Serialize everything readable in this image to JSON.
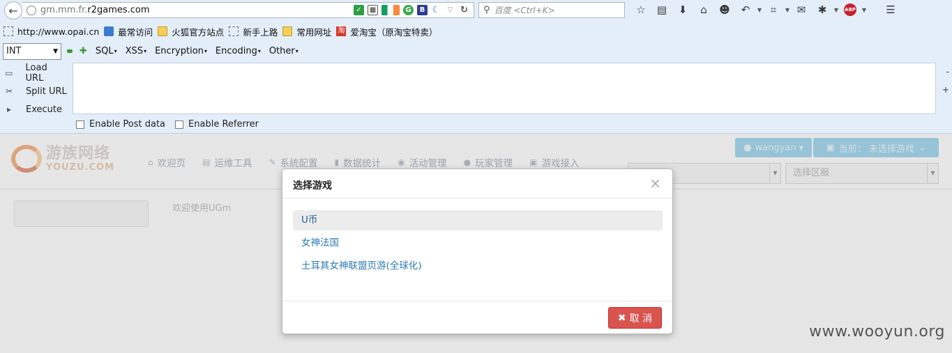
{
  "browser": {
    "url_prefix": "gm.mm.fr.",
    "url_domain": "r2games.com",
    "search_placeholder": "百度 <Ctrl+K>",
    "toolbar_icons": [
      "star-icon",
      "reading-list-icon",
      "download-icon",
      "home-icon",
      "smiley-icon",
      "undo-icon",
      "crop-icon",
      "chat-icon",
      "bug-icon",
      "adblock-icon",
      "menu-icon"
    ],
    "adblock_label": "ABP"
  },
  "bookmarks": [
    {
      "label": "http://www.opai.cn",
      "icon": "dashed-page-icon"
    },
    {
      "label": "最常访问",
      "icon": "blue-page-icon"
    },
    {
      "label": "火狐官方站点",
      "icon": "folder-icon"
    },
    {
      "label": "新手上路",
      "icon": "dashed-page-icon"
    },
    {
      "label": "常用网址",
      "icon": "folder-icon"
    },
    {
      "label": "爱淘宝（原淘宝特卖）",
      "icon": "taobao-icon",
      "icon_text": "淘"
    }
  ],
  "hackbar": {
    "select_value": "INT",
    "menus": [
      "SQL",
      "XSS",
      "Encryption",
      "Encoding",
      "Other"
    ],
    "load_url": "Load URL",
    "split_url": "Split URL",
    "execute": "Execute",
    "minus": "-",
    "plus": "+",
    "enable_post": "Enable Post data",
    "enable_referrer": "Enable Referrer"
  },
  "site": {
    "logo_cn": "游族网络",
    "logo_en": "YOUZU.COM",
    "nav": [
      {
        "label": "欢迎页",
        "icon": "home-icon",
        "glyph": "⌂"
      },
      {
        "label": "运维工具",
        "icon": "tools-icon",
        "glyph": "▤"
      },
      {
        "label": "系统配置",
        "icon": "wrench-icon",
        "glyph": "✎"
      },
      {
        "label": "数据统计",
        "icon": "bar-chart-icon",
        "glyph": "▮"
      },
      {
        "label": "活动管理",
        "icon": "globe-icon",
        "glyph": "◉"
      },
      {
        "label": "玩家管理",
        "icon": "user-icon",
        "glyph": "●"
      },
      {
        "label": "游戏接入",
        "icon": "book-icon",
        "glyph": "▣"
      }
    ],
    "user_name": "wangyan",
    "current_game": "当前： 未选择游戏",
    "server_placeholder": "选择区服",
    "welcome": "欢迎使用UGm"
  },
  "modal": {
    "title": "选择游戏",
    "close": "×",
    "games": [
      "U币",
      "女神法国",
      "土耳其女神联盟页游(全球化)"
    ],
    "cancel": "取 消"
  },
  "watermark": "www.wooyun.org"
}
